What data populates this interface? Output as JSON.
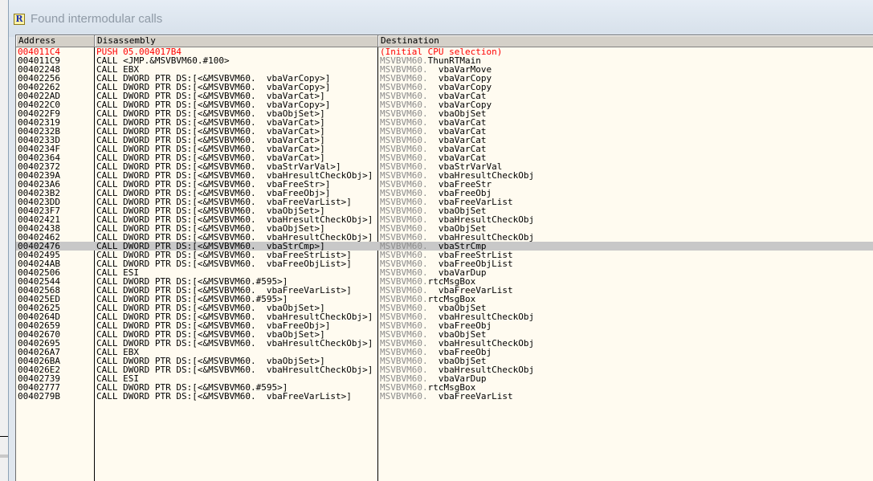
{
  "window": {
    "icon_letter": "R",
    "title": "Found intermodular calls"
  },
  "columns": {
    "address": "Address",
    "disassembly": "Disassembly",
    "destination": "Destination"
  },
  "rows": [
    {
      "addr": "004011C4",
      "dis": "PUSH 05.004017B4",
      "mod": "",
      "fn": "(Initial CPU selection)",
      "style": "red"
    },
    {
      "addr": "004011C9",
      "dis": "CALL <JMP.&MSVBVM60.#100>",
      "mod": "MSVBVM60.",
      "fn": "ThunRTMain",
      "style": ""
    },
    {
      "addr": "00402248",
      "dis": "CALL EBX",
      "mod": "MSVBVM60.",
      "fn": "__vbaVarMove",
      "style": ""
    },
    {
      "addr": "00402256",
      "dis": "CALL DWORD PTR DS:[<&MSVBVM60.__vbaVarCopy>]",
      "mod": "MSVBVM60.",
      "fn": "__vbaVarCopy",
      "style": ""
    },
    {
      "addr": "00402262",
      "dis": "CALL DWORD PTR DS:[<&MSVBVM60.__vbaVarCopy>]",
      "mod": "MSVBVM60.",
      "fn": "__vbaVarCopy",
      "style": ""
    },
    {
      "addr": "004022AD",
      "dis": "CALL DWORD PTR DS:[<&MSVBVM60.__vbaVarCat>]",
      "mod": "MSVBVM60.",
      "fn": "__vbaVarCat",
      "style": ""
    },
    {
      "addr": "004022C0",
      "dis": "CALL DWORD PTR DS:[<&MSVBVM60.__vbaVarCopy>]",
      "mod": "MSVBVM60.",
      "fn": "__vbaVarCopy",
      "style": ""
    },
    {
      "addr": "004022F9",
      "dis": "CALL DWORD PTR DS:[<&MSVBVM60.__vbaObjSet>]",
      "mod": "MSVBVM60.",
      "fn": "__vbaObjSet",
      "style": ""
    },
    {
      "addr": "00402319",
      "dis": "CALL DWORD PTR DS:[<&MSVBVM60.__vbaVarCat>]",
      "mod": "MSVBVM60.",
      "fn": "__vbaVarCat",
      "style": ""
    },
    {
      "addr": "0040232B",
      "dis": "CALL DWORD PTR DS:[<&MSVBVM60.__vbaVarCat>]",
      "mod": "MSVBVM60.",
      "fn": "__vbaVarCat",
      "style": ""
    },
    {
      "addr": "0040233D",
      "dis": "CALL DWORD PTR DS:[<&MSVBVM60.__vbaVarCat>]",
      "mod": "MSVBVM60.",
      "fn": "__vbaVarCat",
      "style": ""
    },
    {
      "addr": "0040234F",
      "dis": "CALL DWORD PTR DS:[<&MSVBVM60.__vbaVarCat>]",
      "mod": "MSVBVM60.",
      "fn": "__vbaVarCat",
      "style": ""
    },
    {
      "addr": "00402364",
      "dis": "CALL DWORD PTR DS:[<&MSVBVM60.__vbaVarCat>]",
      "mod": "MSVBVM60.",
      "fn": "__vbaVarCat",
      "style": ""
    },
    {
      "addr": "00402372",
      "dis": "CALL DWORD PTR DS:[<&MSVBVM60.__vbaStrVarVal>]",
      "mod": "MSVBVM60.",
      "fn": "__vbaStrVarVal",
      "style": ""
    },
    {
      "addr": "0040239A",
      "dis": "CALL DWORD PTR DS:[<&MSVBVM60.__vbaHresultCheckObj>]",
      "mod": "MSVBVM60.",
      "fn": "__vbaHresultCheckObj",
      "style": ""
    },
    {
      "addr": "004023A6",
      "dis": "CALL DWORD PTR DS:[<&MSVBVM60.__vbaFreeStr>]",
      "mod": "MSVBVM60.",
      "fn": "__vbaFreeStr",
      "style": ""
    },
    {
      "addr": "004023B2",
      "dis": "CALL DWORD PTR DS:[<&MSVBVM60.__vbaFreeObj>]",
      "mod": "MSVBVM60.",
      "fn": "__vbaFreeObj",
      "style": ""
    },
    {
      "addr": "004023DD",
      "dis": "CALL DWORD PTR DS:[<&MSVBVM60.__vbaFreeVarList>]",
      "mod": "MSVBVM60.",
      "fn": "__vbaFreeVarList",
      "style": ""
    },
    {
      "addr": "004023F7",
      "dis": "CALL DWORD PTR DS:[<&MSVBVM60.__vbaObjSet>]",
      "mod": "MSVBVM60.",
      "fn": "__vbaObjSet",
      "style": ""
    },
    {
      "addr": "00402421",
      "dis": "CALL DWORD PTR DS:[<&MSVBVM60.__vbaHresultCheckObj>]",
      "mod": "MSVBVM60.",
      "fn": "__vbaHresultCheckObj",
      "style": ""
    },
    {
      "addr": "00402438",
      "dis": "CALL DWORD PTR DS:[<&MSVBVM60.__vbaObjSet>]",
      "mod": "MSVBVM60.",
      "fn": "__vbaObjSet",
      "style": ""
    },
    {
      "addr": "00402462",
      "dis": "CALL DWORD PTR DS:[<&MSVBVM60.__vbaHresultCheckObj>]",
      "mod": "MSVBVM60.",
      "fn": "__vbaHresultCheckObj",
      "style": ""
    },
    {
      "addr": "00402476",
      "dis": "CALL DWORD PTR DS:[<&MSVBVM60.__vbaStrCmp>]",
      "mod": "MSVBVM60.",
      "fn": "__vbaStrCmp",
      "style": "selected"
    },
    {
      "addr": "00402495",
      "dis": "CALL DWORD PTR DS:[<&MSVBVM60.__vbaFreeStrList>]",
      "mod": "MSVBVM60.",
      "fn": "__vbaFreeStrList",
      "style": ""
    },
    {
      "addr": "004024AB",
      "dis": "CALL DWORD PTR DS:[<&MSVBVM60.__vbaFreeObjList>]",
      "mod": "MSVBVM60.",
      "fn": "__vbaFreeObjList",
      "style": ""
    },
    {
      "addr": "00402506",
      "dis": "CALL ESI",
      "mod": "MSVBVM60.",
      "fn": "__vbaVarDup",
      "style": ""
    },
    {
      "addr": "00402544",
      "dis": "CALL DWORD PTR DS:[<&MSVBVM60.#595>]",
      "mod": "MSVBVM60.",
      "fn": "rtcMsgBox",
      "style": ""
    },
    {
      "addr": "00402568",
      "dis": "CALL DWORD PTR DS:[<&MSVBVM60.__vbaFreeVarList>]",
      "mod": "MSVBVM60.",
      "fn": "__vbaFreeVarList",
      "style": ""
    },
    {
      "addr": "004025ED",
      "dis": "CALL DWORD PTR DS:[<&MSVBVM60.#595>]",
      "mod": "MSVBVM60.",
      "fn": "rtcMsgBox",
      "style": ""
    },
    {
      "addr": "00402625",
      "dis": "CALL DWORD PTR DS:[<&MSVBVM60.__vbaObjSet>]",
      "mod": "MSVBVM60.",
      "fn": "__vbaObjSet",
      "style": ""
    },
    {
      "addr": "0040264D",
      "dis": "CALL DWORD PTR DS:[<&MSVBVM60.__vbaHresultCheckObj>]",
      "mod": "MSVBVM60.",
      "fn": "__vbaHresultCheckObj",
      "style": ""
    },
    {
      "addr": "00402659",
      "dis": "CALL DWORD PTR DS:[<&MSVBVM60.__vbaFreeObj>]",
      "mod": "MSVBVM60.",
      "fn": "__vbaFreeObj",
      "style": ""
    },
    {
      "addr": "00402670",
      "dis": "CALL DWORD PTR DS:[<&MSVBVM60.__vbaObjSet>]",
      "mod": "MSVBVM60.",
      "fn": "__vbaObjSet",
      "style": ""
    },
    {
      "addr": "00402695",
      "dis": "CALL DWORD PTR DS:[<&MSVBVM60.__vbaHresultCheckObj>]",
      "mod": "MSVBVM60.",
      "fn": "__vbaHresultCheckObj",
      "style": ""
    },
    {
      "addr": "004026A7",
      "dis": "CALL EBX",
      "mod": "MSVBVM60.",
      "fn": "__vbaFreeObj",
      "style": ""
    },
    {
      "addr": "004026BA",
      "dis": "CALL DWORD PTR DS:[<&MSVBVM60.__vbaObjSet>]",
      "mod": "MSVBVM60.",
      "fn": "__vbaObjSet",
      "style": ""
    },
    {
      "addr": "004026E2",
      "dis": "CALL DWORD PTR DS:[<&MSVBVM60.__vbaHresultCheckObj>]",
      "mod": "MSVBVM60.",
      "fn": "__vbaHresultCheckObj",
      "style": ""
    },
    {
      "addr": "00402739",
      "dis": "CALL ESI",
      "mod": "MSVBVM60.",
      "fn": "__vbaVarDup",
      "style": ""
    },
    {
      "addr": "00402777",
      "dis": "CALL DWORD PTR DS:[<&MSVBVM60.#595>]",
      "mod": "MSVBVM60.",
      "fn": "rtcMsgBox",
      "style": ""
    },
    {
      "addr": "0040279B",
      "dis": "CALL DWORD PTR DS:[<&MSVBVM60.__vbaFreeVarList>]",
      "mod": "MSVBVM60.",
      "fn": "__vbaFreeVarList",
      "style": ""
    }
  ]
}
